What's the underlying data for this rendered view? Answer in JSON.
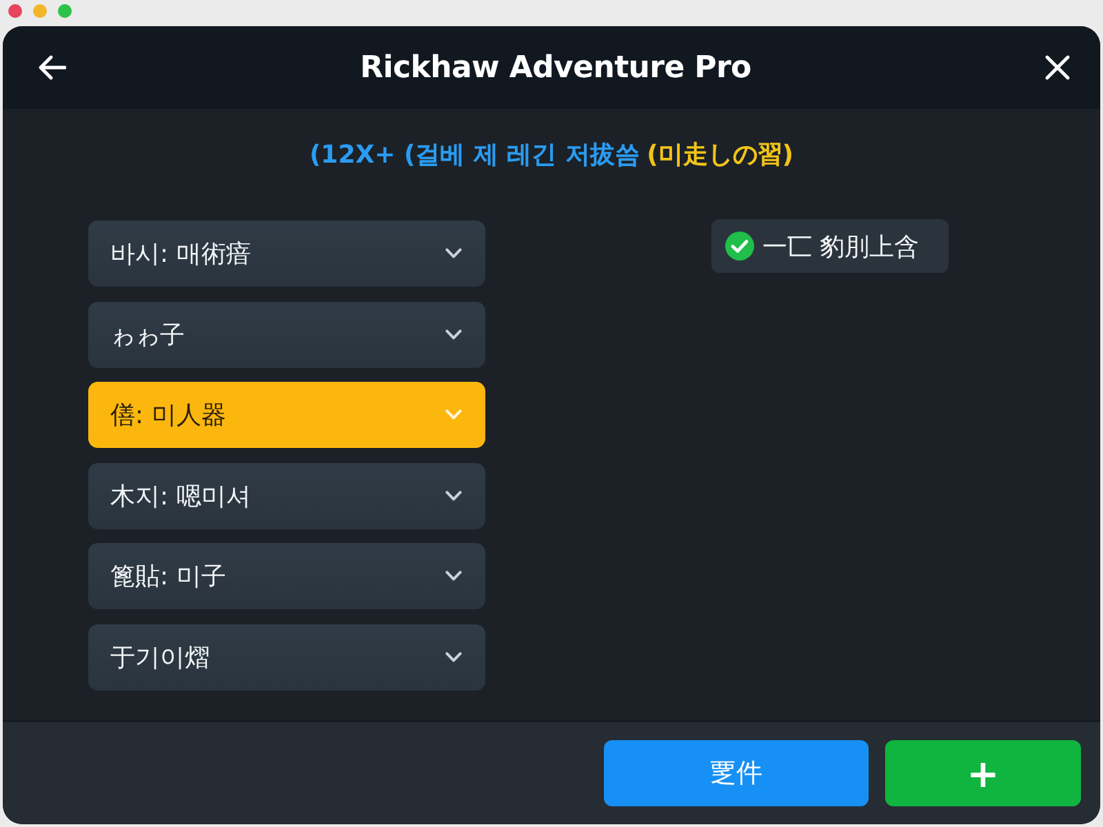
{
  "window": {
    "title": "Rickhaw Adventure Pro"
  },
  "subtitle": {
    "text": "(12X+ (걸베 제 레긴 저拔씀",
    "note": "(미走しの習)"
  },
  "dropdowns": [
    {
      "label": "바시: 매術瘖",
      "selected": false
    },
    {
      "label": "ゎゎ子",
      "selected": false
    },
    {
      "label": "僐: 미人器",
      "selected": true
    },
    {
      "label": "木지: 嗯미셔",
      "selected": false
    },
    {
      "label": "篦貼: 미子",
      "selected": false
    },
    {
      "label": "于기이熠",
      "selected": false
    }
  ],
  "status_chip": {
    "label": "一匸 豹刖上含"
  },
  "buttons": [
    {
      "label": "覂件",
      "kind": "primary"
    },
    {
      "label": "+",
      "kind": "add"
    }
  ]
}
